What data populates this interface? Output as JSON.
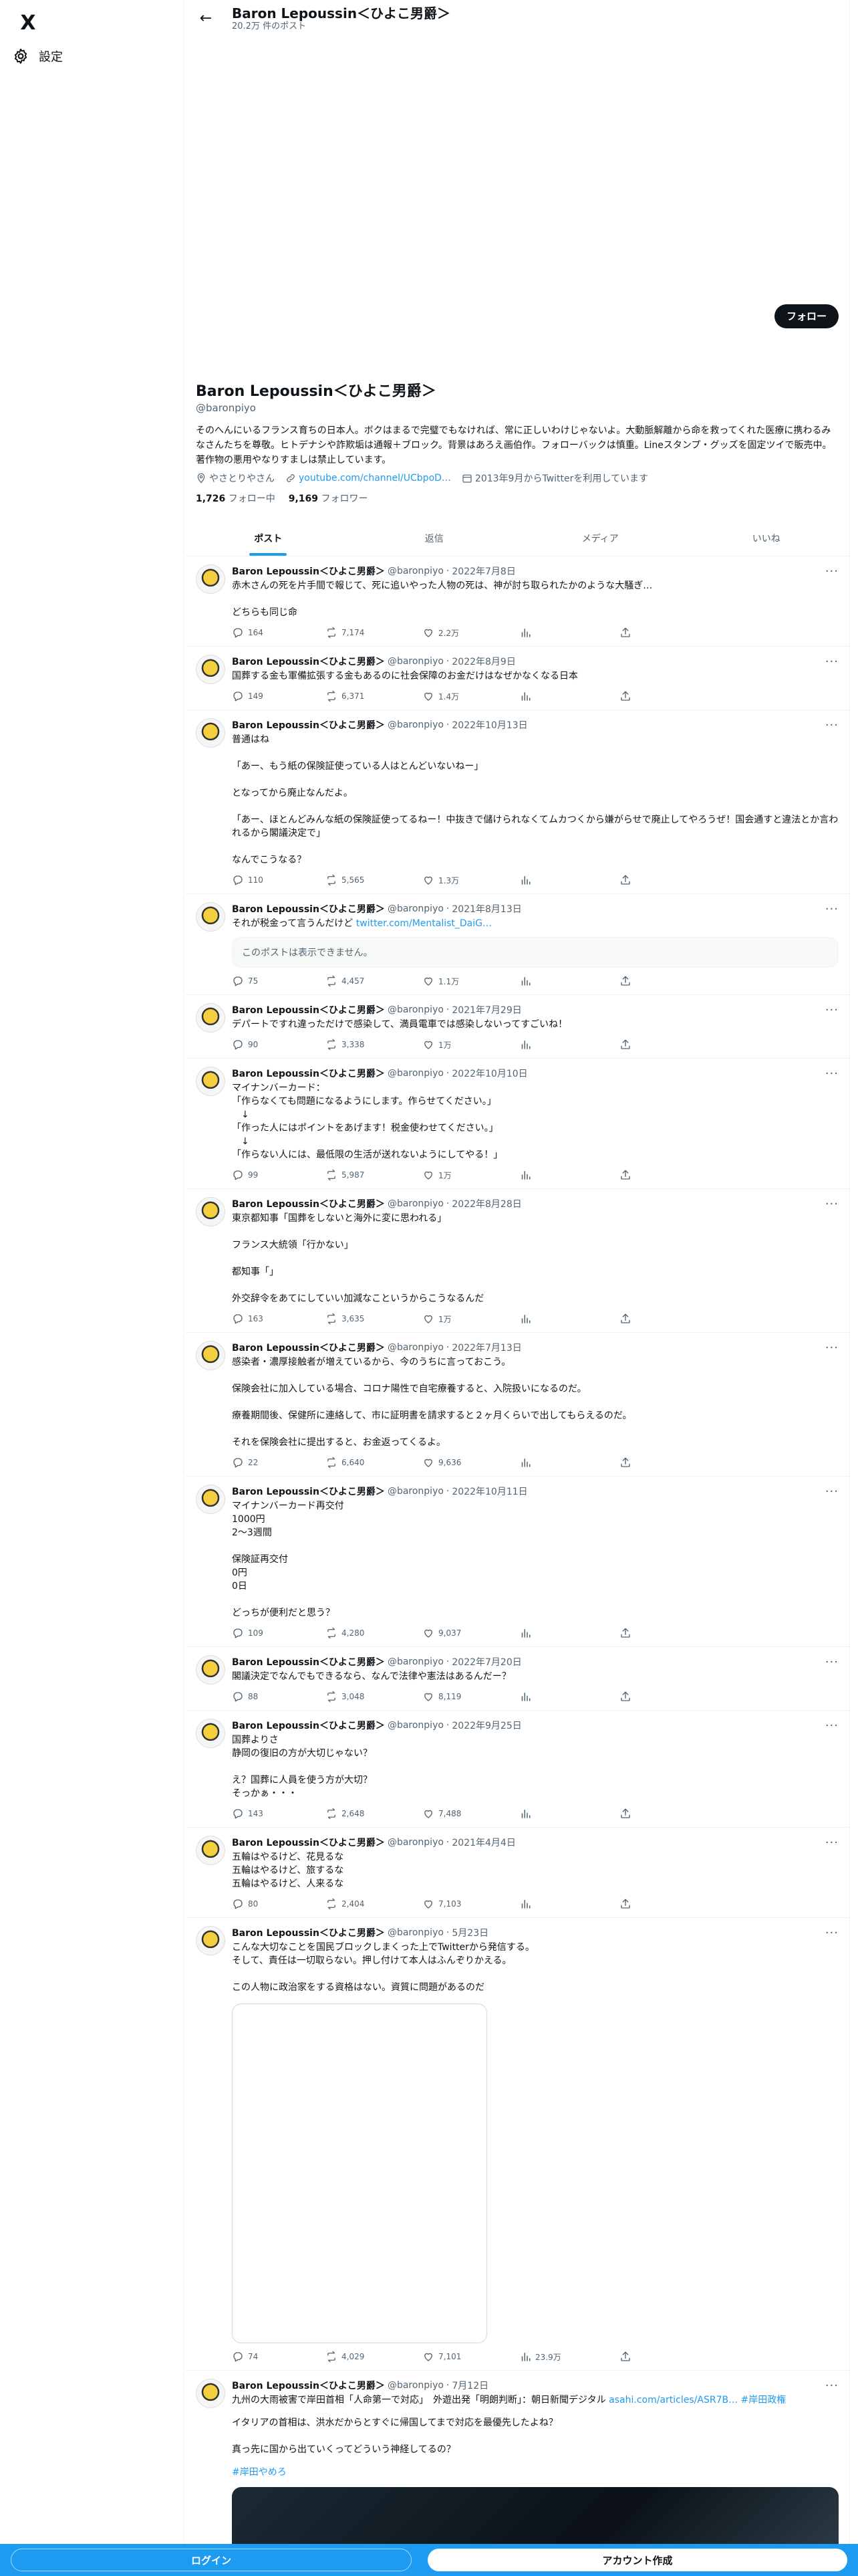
{
  "nav": {
    "logo": "X",
    "settings_label": "設定"
  },
  "header": {
    "name": "Baron Lepoussin＜ひよこ男爵＞",
    "post_count": "20.2万 件のポスト"
  },
  "profile": {
    "follow_label": "フォロー",
    "name": "Baron Lepoussin＜ひよこ男爵＞",
    "handle": "@baronpiyo",
    "bio": "そのへんにいるフランス育ちの日本人。ボクはまるで完璧でもなければ、常に正しいわけじゃないよ。大動脈解離から命を救ってくれた医療に携わるみなさんたちを尊敬。ヒトデナシや詐欺垢は通報＋ブロック。背景はあろえ画伯作。フォローバックは慎重。Lineスタンプ・グッズを固定ツイで販売中。著作物の悪用やなりすましは禁止しています。",
    "location": "やさとりやさん",
    "link": "youtube.com/channel/UCbpoD…",
    "joined": "2013年9月からTwitterを利用しています",
    "following_count": "1,726",
    "following_label": "フォロー中",
    "followers_count": "9,169",
    "followers_label": "フォロワー"
  },
  "tabs": [
    "ポスト",
    "返信",
    "メディア",
    "いいね"
  ],
  "tweets": [
    {
      "name": "Baron Lepoussin＜ひよこ男爵＞",
      "handle": "@baronpiyo",
      "date": "2022年7月8日",
      "text": "赤木さんの死を片手間で報じて、死に追いやった人物の死は、神が討ち取られたかのような大騒ぎ…\n\nどちらも同じ命",
      "replies": "164",
      "retweets": "7,174",
      "likes": "2.2万"
    },
    {
      "name": "Baron Lepoussin＜ひよこ男爵＞",
      "handle": "@baronpiyo",
      "date": "2022年8月9日",
      "text": "国葬する金も軍備拡張する金もあるのに社会保障のお金だけはなぜかなくなる日本",
      "replies": "149",
      "retweets": "6,371",
      "likes": "1.4万"
    },
    {
      "name": "Baron Lepoussin＜ひよこ男爵＞",
      "handle": "@baronpiyo",
      "date": "2022年10月13日",
      "text": "普通はね\n\n「あー、もう紙の保険証使っている人はとんどいないねー」\n\nとなってから廃止なんだよ。\n\n「あー、ほとんどみんな紙の保険証使ってるねー！中抜きで儲けられなくてムカつくから嫌がらせで廃止してやろうぜ！国会通すと違法とか言われるから閣議決定で」\n\nなんでこうなる？",
      "replies": "110",
      "retweets": "5,565",
      "likes": "1.3万"
    },
    {
      "name": "Baron Lepoussin＜ひよこ男爵＞",
      "handle": "@baronpiyo",
      "date": "2021年8月13日",
      "text": "それが税金って言うんだけど ",
      "link": "twitter.com/Mentalist_DaiG…",
      "card": "このポストは表示できません。",
      "replies": "75",
      "retweets": "4,457",
      "likes": "1.1万"
    },
    {
      "name": "Baron Lepoussin＜ひよこ男爵＞",
      "handle": "@baronpiyo",
      "date": "2021年7月29日",
      "text": "デパートですれ違っただけで感染して、満員電車では感染しないってすごいね！",
      "replies": "90",
      "retweets": "3,338",
      "likes": "1万"
    },
    {
      "name": "Baron Lepoussin＜ひよこ男爵＞",
      "handle": "@baronpiyo",
      "date": "2022年10月10日",
      "text": "マイナンバーカード：\n「作らなくても問題になるようにします。作らせてください。」\n　↓\n「作った人にはポイントをあげます！税金使わせてください。」\n　↓\n「作らない人には、最低限の生活が送れないようにしてやる！」",
      "replies": "99",
      "retweets": "5,987",
      "likes": "1万"
    },
    {
      "name": "Baron Lepoussin＜ひよこ男爵＞",
      "handle": "@baronpiyo",
      "date": "2022年8月28日",
      "text": "東京都知事「国葬をしないと海外に変に思われる」\n\nフランス大統領「行かない」\n\n都知事「」\n\n外交辞令をあてにしていい加減なこというからこうなるんだ",
      "replies": "163",
      "retweets": "3,635",
      "likes": "1万"
    },
    {
      "name": "Baron Lepoussin＜ひよこ男爵＞",
      "handle": "@baronpiyo",
      "date": "2022年7月13日",
      "text": "感染者・濃厚接触者が増えているから、今のうちに言っておこう。\n\n保険会社に加入している場合、コロナ陽性で自宅療養すると、入院扱いになるのだ。\n\n療養期間後、保健所に連絡して、市に証明書を請求すると２ヶ月くらいで出してもらえるのだ。\n\nそれを保険会社に提出すると、お金返ってくるよ。",
      "replies": "22",
      "retweets": "6,640",
      "likes": "9,636"
    },
    {
      "name": "Baron Lepoussin＜ひよこ男爵＞",
      "handle": "@baronpiyo",
      "date": "2022年10月11日",
      "text": "マイナンバーカード再交付\n1000円\n2〜3週間\n\n保険証再交付\n0円\n0日\n\nどっちが便利だと思う？",
      "replies": "109",
      "retweets": "4,280",
      "likes": "9,037"
    },
    {
      "name": "Baron Lepoussin＜ひよこ男爵＞",
      "handle": "@baronpiyo",
      "date": "2022年7月20日",
      "text": "閣議決定でなんでもできるなら、なんで法律や憲法はあるんだー？",
      "replies": "88",
      "retweets": "3,048",
      "likes": "8,119"
    },
    {
      "name": "Baron Lepoussin＜ひよこ男爵＞",
      "handle": "@baronpiyo",
      "date": "2022年9月25日",
      "text": "国葬よりさ\n静岡の復旧の方が大切じゃない？\n\nえ？国葬に人員を使う方が大切？\nそっかぁ・・・",
      "replies": "143",
      "retweets": "2,648",
      "likes": "7,488"
    },
    {
      "name": "Baron Lepoussin＜ひよこ男爵＞",
      "handle": "@baronpiyo",
      "date": "2021年4月4日",
      "text": "五輪はやるけど、花見るな\n五輪はやるけど、旅するな\n五輪はやるけど、人来るな",
      "replies": "80",
      "retweets": "2,404",
      "likes": "7,103"
    },
    {
      "name": "Baron Lepoussin＜ひよこ男爵＞",
      "handle": "@baronpiyo",
      "date": "5月23日",
      "text": "こんな大切なことを国民ブロックしまくった上でTwitterから発信する。\nそして、責任は一切取らない。押し付けて本人はふんぞりかえる。\n\nこの人物に政治家をする資格はない。資質に問題があるのだ",
      "media": true,
      "replies": "74",
      "retweets": "4,029",
      "likes": "7,101",
      "views": "23.9万"
    },
    {
      "name": "Baron Lepoussin＜ひよこ男爵＞",
      "handle": "@baronpiyo",
      "date": "7月12日",
      "text": "九州の大雨被害で岸田首相「人命第一で対応」　外遊出発「明朗判断」：朝日新聞デジタル ",
      "link": "asahi.com/articles/ASR7B…",
      "hashtag1": " #岸田政権",
      "text2": "イタリアの首相は、洪水だからとすぐに帰国してまで対応を最優先したよね？\n\n真っ先に国から出ていくってどういう神経してるの？",
      "hashtag2": "#岸田やめろ",
      "media_dark": true
    }
  ],
  "bottombar": {
    "login": "ログイン",
    "signup": "アカウント作成"
  }
}
